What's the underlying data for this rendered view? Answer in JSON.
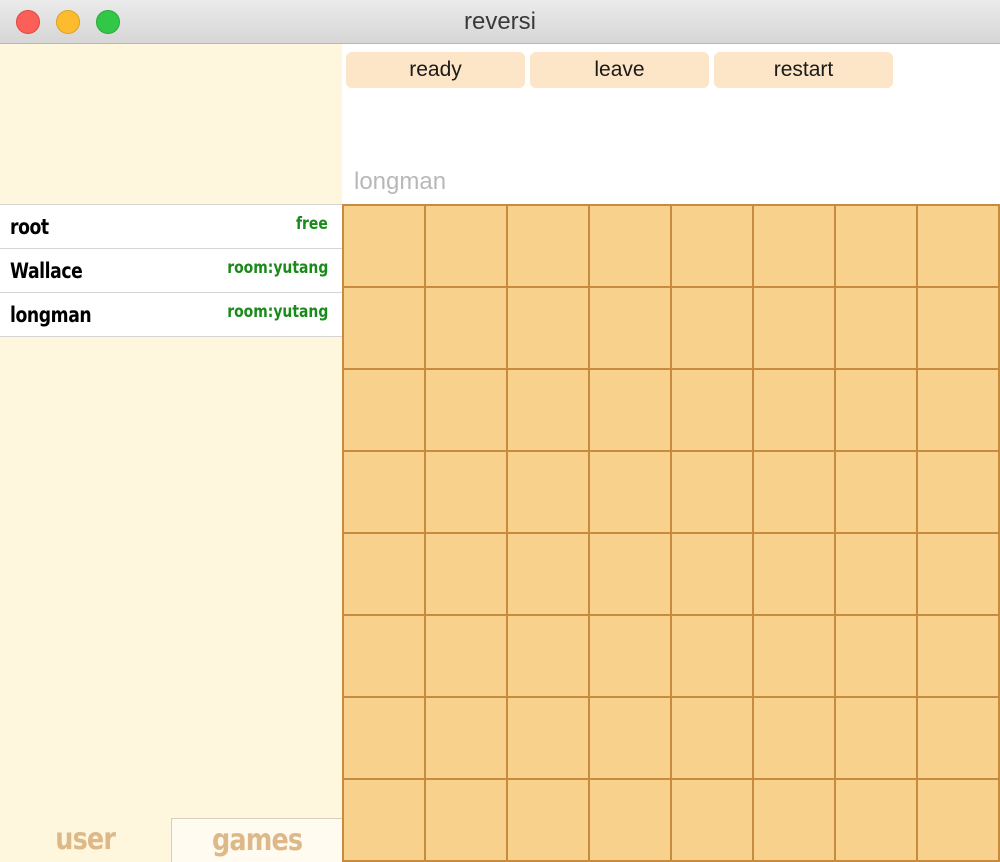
{
  "window": {
    "title": "reversi"
  },
  "actions": {
    "ready_label": "ready",
    "leave_label": "leave",
    "restart_label": "restart"
  },
  "game": {
    "player_name": "longman",
    "board_rows": 8,
    "board_cols": 8
  },
  "users": [
    {
      "name": "root",
      "status": "free"
    },
    {
      "name": "Wallace",
      "status": "room:yutang"
    },
    {
      "name": "longman",
      "status": "room:yutang"
    }
  ],
  "tabs": {
    "user_label": "user",
    "games_label": "games"
  },
  "colors": {
    "board_fill": "#f8d28c",
    "board_line": "#c68b3c",
    "button_bg": "#fde5c7",
    "sidebar_bg": "#fef7dd",
    "status_green": "#1a8a1a",
    "tab_text": "#ddb98a"
  }
}
